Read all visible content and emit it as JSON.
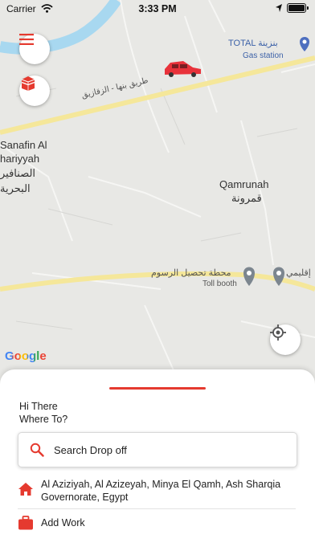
{
  "status_bar": {
    "carrier": "Carrier",
    "time": "3:33 PM"
  },
  "map": {
    "labels": {
      "road_arabic": "طريق بنها - الزقازيق",
      "gas_station_arabic": "TOTAL بنزينة",
      "gas_station_en": "Gas station",
      "sanafin_line1": "Sanafin Al",
      "sanafin_line2": "hariyyah",
      "sanafin_ar1": "الصنافير",
      "sanafin_ar2": "البحرية",
      "qamrunah_en": "Qamrunah",
      "qamrunah_ar": "قمرونة",
      "toll_ar": "محطة تحصيل الرسوم",
      "toll_en": "Toll booth",
      "regional_ar": "إقليمي"
    },
    "google_logo": "Google"
  },
  "colors": {
    "accent": "#e53a2f",
    "car": "#e8323a",
    "road": "#f5e79a",
    "map_bg": "#e8e8e5",
    "water": "#a8d8f0"
  },
  "icons": {
    "menu": "hamburger-icon",
    "kaaba": "kaaba-icon",
    "locate": "crosshair-icon",
    "search": "search-icon",
    "home": "home-icon",
    "work": "briefcase-icon"
  },
  "sheet": {
    "greeting_line1": "Hi There",
    "greeting_line2": "Where To?",
    "search_placeholder": "Search Drop off",
    "home_address": "Al Aziziyah, Al Azizeyah, Minya El Qamh, Ash Sharqia Governorate, Egypt",
    "add_work_label": "Add Work"
  }
}
